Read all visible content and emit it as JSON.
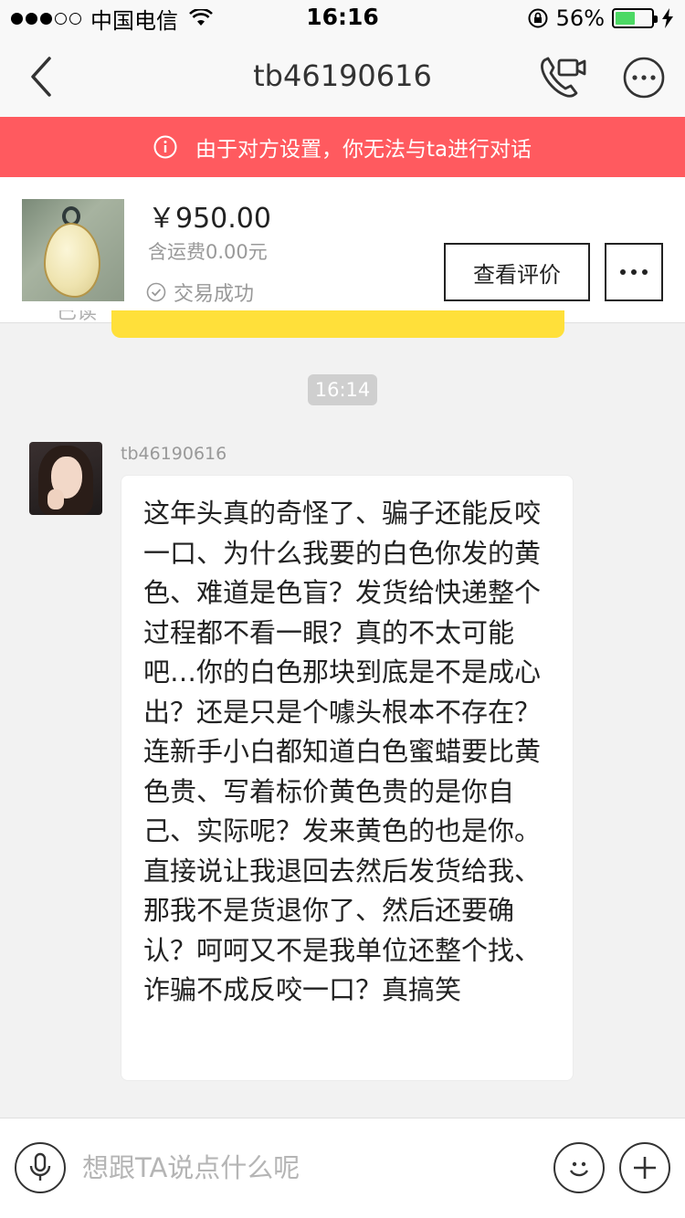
{
  "status_bar": {
    "carrier": "中国电信",
    "time": "16:16",
    "battery_percent": "56%",
    "battery_level": 0.56,
    "signal_bars_filled": 3,
    "signal_bars_total": 5
  },
  "nav": {
    "title": "tb46190616"
  },
  "alert": {
    "text": "由于对方设置，你无法与ta进行对话",
    "color": "#ff5a5f"
  },
  "order": {
    "price": "￥950.00",
    "shipping": "含运费0.00元",
    "status": "交易成功",
    "review_button": "查看评价"
  },
  "chat": {
    "read_label": "已读",
    "timestamp": "16:14",
    "message": {
      "sender": "tb46190616",
      "text": "这年头真的奇怪了、骗子还能反咬一口、为什么我要的白色你发的黄色、难道是色盲？发货给快递整个过程都不看一眼？真的不太可能吧…你的白色那块到底是不是成心出？还是只是个噱头根本不存在？连新手小白都知道白色蜜蜡要比黄色贵、写着标价黄色贵的是你自己、实际呢？发来黄色的也是你。直接说让我退回去然后发货给我、那我不是货退你了、然后还要确认？呵呵又不是我单位还整个找、诈骗不成反咬一口？真搞笑"
    }
  },
  "input_bar": {
    "placeholder": "想跟TA说点什么呢",
    "value": ""
  },
  "icons": {
    "back": "chevron-left-icon",
    "call": "phone-video-icon",
    "more": "more-dots-icon",
    "info": "info-icon",
    "check": "check-circle-icon",
    "mic": "microphone-icon",
    "emoji": "smiley-icon",
    "plus": "plus-icon"
  }
}
